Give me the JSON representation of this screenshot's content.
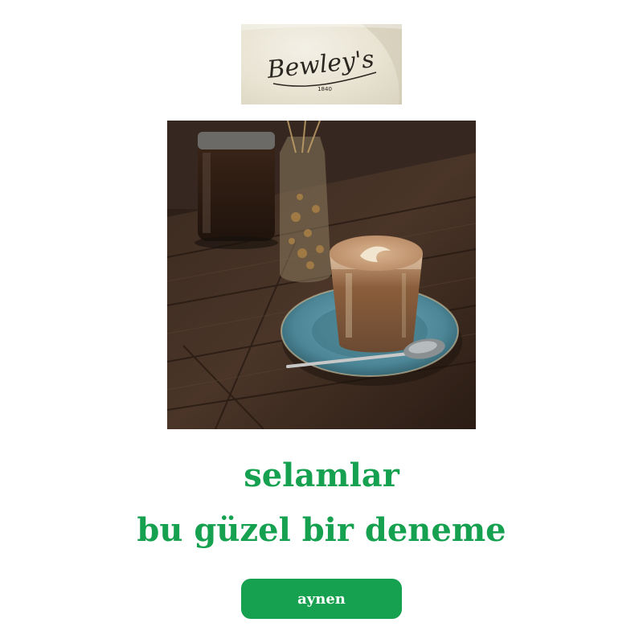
{
  "logo": {
    "brand": "Bewley's",
    "year": "1840"
  },
  "photo": {
    "subject": "latte-with-saucer-and-spoon"
  },
  "headline": {
    "line1": "selamlar",
    "line2": "bu güzel bir deneme"
  },
  "cta": {
    "label": "aynen"
  },
  "colors": {
    "accent": "#16a150",
    "background": "#ffffff",
    "button_text": "#ffffff"
  }
}
